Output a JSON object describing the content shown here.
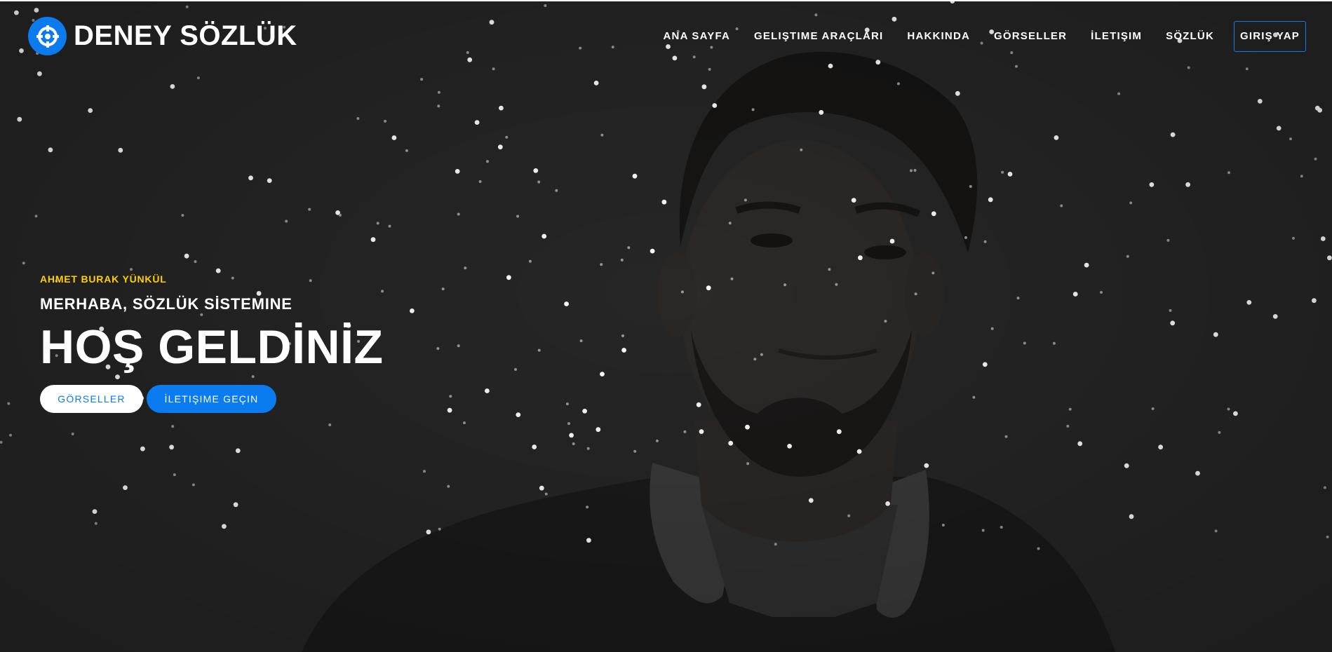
{
  "header": {
    "brand_name": "DENEY SÖZLÜK",
    "brand_icon": "crosshair-icon",
    "nav": [
      {
        "label": "ANA SAYFA"
      },
      {
        "label": "GELIŞTIME ARAÇLARI"
      },
      {
        "label": "HAKKINDA"
      },
      {
        "label": "GÖRSELLER"
      },
      {
        "label": "İLETIŞIM"
      },
      {
        "label": "SÖZLÜK"
      }
    ],
    "login_label": "GIRIŞ YAP"
  },
  "hero": {
    "kicker": "AHMET BURAK YÜNKÜL",
    "subtitle": "MERHABA, SÖZLÜK SİSTEMINE",
    "headline": "HOŞ GELDİNİZ",
    "btn_gallery": "GÖRSELLER",
    "btn_contact": "İLETIŞIME GEÇIN"
  },
  "colors": {
    "accent": "#0a7cf0",
    "kicker": "#ffd000",
    "background": "#262626"
  }
}
